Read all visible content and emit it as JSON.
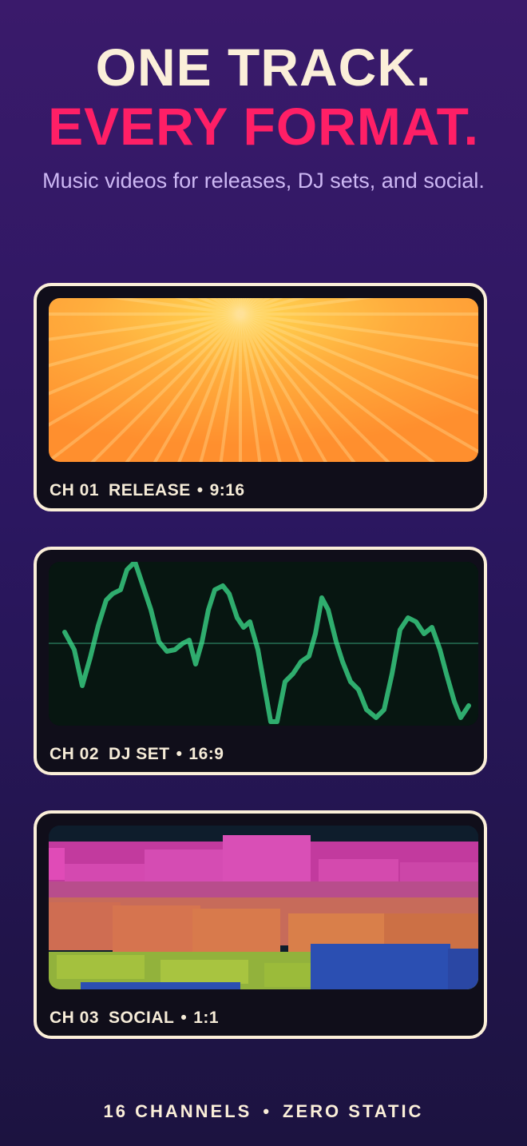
{
  "headline": {
    "line1": "ONE TRACK.",
    "line2": "EVERY FORMAT."
  },
  "subtitle": "Music videos for releases, DJ sets, and social.",
  "cards": [
    {
      "channel": "CH 01",
      "type": "RELEASE",
      "bullet": "•",
      "ratio": "9:16"
    },
    {
      "channel": "CH 02",
      "type": "DJ SET",
      "bullet": "•",
      "ratio": "16:9"
    },
    {
      "channel": "CH 03",
      "type": "SOCIAL",
      "bullet": "•",
      "ratio": "1:1"
    }
  ],
  "footer": {
    "left": "16 CHANNELS",
    "bullet": "•",
    "right": "ZERO STATIC"
  },
  "colors": {
    "accent_pink": "#ff1f66",
    "cream": "#fbefd9",
    "lavender": "#cdb8f4"
  }
}
